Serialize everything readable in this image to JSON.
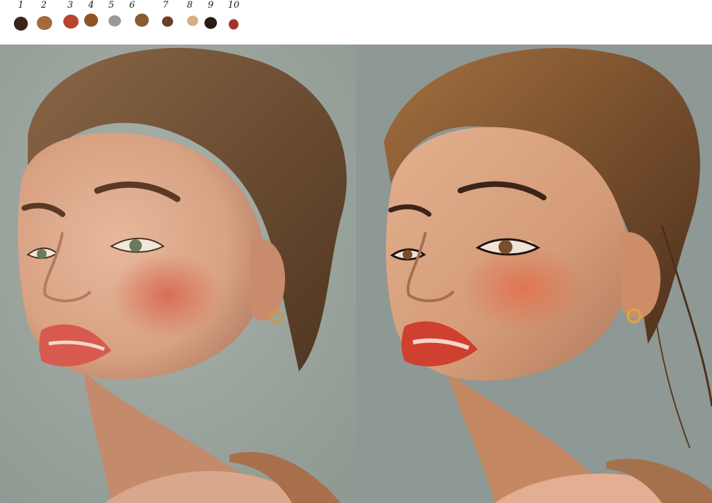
{
  "palette": {
    "swatches": [
      {
        "number": "1",
        "color": "#3b2418"
      },
      {
        "number": "2",
        "color": "#a46a3a"
      },
      {
        "number": "3",
        "color": "#b8452f"
      },
      {
        "number": "4",
        "color": "#8e5528"
      },
      {
        "number": "5",
        "color": "#959a9a"
      },
      {
        "number": "6",
        "color": "#8a5a30"
      },
      {
        "number": "7",
        "color": "#6a4124"
      },
      {
        "number": "8",
        "color": "#d9ae86"
      },
      {
        "number": "9",
        "color": "#2a1c14"
      },
      {
        "number": "10",
        "color": "#a8312b"
      }
    ]
  },
  "photo_panel": {
    "background_color": "#9aa39d",
    "skin_color": "#d8a182",
    "hair_color": "#6b4a30",
    "blush_color": "#d86a55",
    "lip_color": "#d85a4e"
  },
  "painting_panel": {
    "background_color": "#8e9894",
    "skin_color": "#d49b78",
    "hair_color": "#7a4e2c",
    "blush_color": "#e0714f",
    "lip_color": "#d0402e"
  }
}
